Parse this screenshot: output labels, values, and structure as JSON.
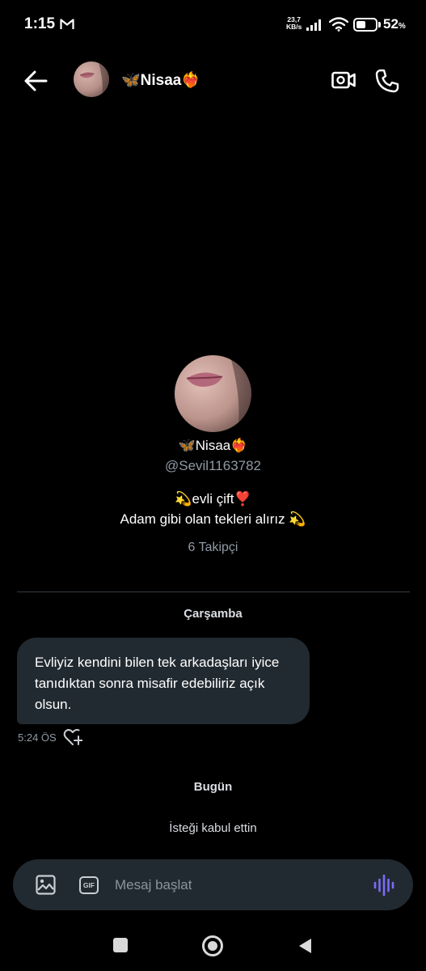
{
  "status_bar": {
    "time": "1:15",
    "net_speed_value": "23,7",
    "net_speed_unit": "KB/s",
    "battery_percent": "52",
    "battery_percent_sign": "%",
    "battery_level": 0.52,
    "icons": [
      "gmail-icon",
      "signal-icon",
      "wifi-icon",
      "battery-icon"
    ]
  },
  "header": {
    "contact_name": "🦋Nisaa❤️‍🔥",
    "icons": [
      "back-arrow-icon",
      "video-camera-icon",
      "phone-icon"
    ]
  },
  "profile": {
    "name": "🦋Nisaa❤️‍🔥",
    "handle": "@Sevil1163782",
    "bio_line1": "💫evli çift❣️",
    "bio_line2": "Adam gibi olan tekleri alırız 💫",
    "followers": "6 Takipçi"
  },
  "conversation": {
    "day1_label": "Çarşamba",
    "message_text": "Evliyiz kendini bilen tek arkadaşları iyice tanıdıktan sonra misafir edebiliriz açık olsun.",
    "message_time": "5:24 ÖS",
    "day2_label": "Bugün",
    "system_text": "İsteği kabul ettin"
  },
  "composer": {
    "placeholder": "Mesaj başlat",
    "gif_label": "GIF",
    "icons": [
      "image-icon",
      "gif-icon",
      "voice-wave-icon"
    ],
    "accent_color": "#7b6cf6"
  },
  "colors": {
    "background": "#000000",
    "bubble": "#222a31",
    "secondary_text": "#9099a3"
  }
}
